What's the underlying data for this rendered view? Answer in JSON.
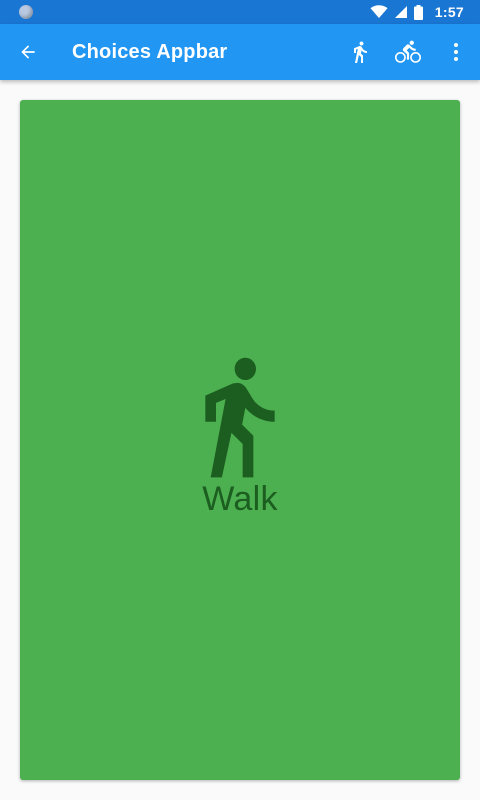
{
  "status_bar": {
    "time": "1:57",
    "icons": [
      "notification-icon",
      "wifi-icon",
      "signal-icon",
      "battery-icon"
    ]
  },
  "app_bar": {
    "title": "Choices Appbar",
    "icons": [
      "back-arrow-icon",
      "walk-icon",
      "bike-icon",
      "more-vert-icon"
    ]
  },
  "card": {
    "label": "Walk",
    "icon": "walk-icon"
  },
  "colors": {
    "status_bar": "#1976d2",
    "app_bar": "#2196f3",
    "card": "#4caf50",
    "card_content": "#1b5e20",
    "background": "#fafafa"
  }
}
